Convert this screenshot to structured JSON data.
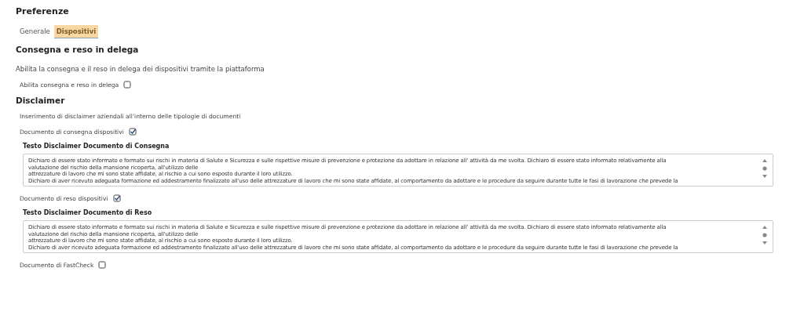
{
  "page_title": "Preferenze",
  "tabs": [
    {
      "label": "Generale",
      "selected": false
    },
    {
      "label": "Dispositivi",
      "selected": true
    }
  ],
  "delegation": {
    "heading": "Consegna e reso in delega",
    "description": "Abilita la consegna e il reso in delega dei dispositivi tramite la piattaforma",
    "option": {
      "label": "Abilita consegna e reso in delega",
      "checked": false
    }
  },
  "disclaimer": {
    "heading": "Disclaimer",
    "description": "Inserimento di disclaimer aziendali all'interno delle tipologie di documenti",
    "documents": [
      {
        "label": "Documento di consegna dispositivi",
        "checked": true,
        "text_heading": "Testo Disclaimer Documento di Consegna",
        "text_lines": [
          "Dichiaro di essere stato informato e formato sui rischi in materia di Salute e Sicurezza e sulle rispettive misure di prevenzione e protezione da adottare in relazione all' attività da me svolta. Dichiaro di essere stato informato relativamente alla",
          "valutazione del rischio della mansione ricoperta, all'utilizzo delle",
          "attrezzature di lavoro che mi sono state affidate, al rischio a cui sono esposto durante il loro utilizzo.",
          "Dichiaro di aver ricevuto adeguata formazione ed addestramento finalizzato all'uso delle attrezzature di lavoro che mi sono state affidate, al comportamento da adottare e le procedure da seguire durante tutte le fasi di lavorazione che prevede la"
        ]
      },
      {
        "label": "Documento di reso dispositivi",
        "checked": true,
        "text_heading": "Testo Disclaimer Documento di Reso",
        "text_lines": [
          "Dichiaro di essere stato informato e formato sui rischi in materia di Salute e Sicurezza e sulle rispettive misure di prevenzione e protezione da adottare in relazione all' attività da me svolta. Dichiaro di essere stato informato relativamente alla",
          "valutazione del rischio della mansione ricoperta, all'utilizzo delle",
          "attrezzature di lavoro che mi sono state affidate, al rischio a cui sono esposto durante il loro utilizzo.",
          "Dichiaro di aver ricevuto adeguata formazione ed addestramento finalizzato all'uso delle attrezzature di lavoro che mi sono state affidate, al comportamento da adottare e le procedure da seguire durante tutte le fasi di lavorazione che prevede la"
        ]
      },
      {
        "label": "Documento di FastCheck",
        "checked": false
      }
    ]
  }
}
